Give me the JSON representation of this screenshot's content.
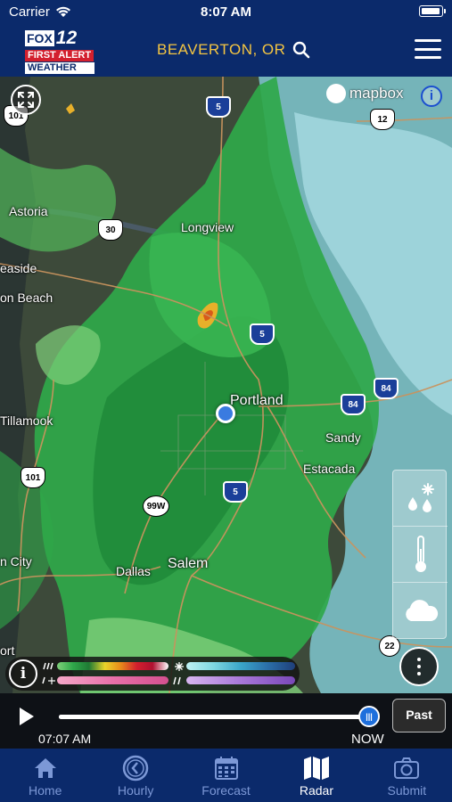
{
  "status_bar": {
    "carrier": "Carrier",
    "time": "8:07 AM"
  },
  "header": {
    "logo_lines": [
      "FOX",
      "12",
      "FIRST ALERT",
      "WEATHER"
    ],
    "location": "BEAVERTON, OR"
  },
  "map": {
    "attribution": "mapbox",
    "cities": [
      {
        "name": "Astoria"
      },
      {
        "name": "Longview"
      },
      {
        "name": "easide"
      },
      {
        "name": "on Beach"
      },
      {
        "name": "Portland"
      },
      {
        "name": "Tillamook"
      },
      {
        "name": "Sandy"
      },
      {
        "name": "Estacada"
      },
      {
        "name": "n City"
      },
      {
        "name": "Dallas"
      },
      {
        "name": "Salem"
      },
      {
        "name": "ort"
      }
    ],
    "shields": [
      {
        "label": "101",
        "kind": "us"
      },
      {
        "label": "5",
        "kind": "interstate"
      },
      {
        "label": "12",
        "kind": "us"
      },
      {
        "label": "30",
        "kind": "us"
      },
      {
        "label": "5",
        "kind": "interstate"
      },
      {
        "label": "84",
        "kind": "interstate"
      },
      {
        "label": "84",
        "kind": "interstate"
      },
      {
        "label": "101",
        "kind": "us"
      },
      {
        "label": "99W",
        "kind": "state"
      },
      {
        "label": "5",
        "kind": "interstate"
      },
      {
        "label": "22",
        "kind": "state"
      }
    ],
    "layer_buttons": [
      "precipitation-type",
      "temperature",
      "clouds"
    ]
  },
  "legend": {
    "info_label": "i"
  },
  "timeline": {
    "start_time": "07:07 AM",
    "end_label": "NOW",
    "progress": 1.0,
    "past_button": "Past"
  },
  "tabs": [
    {
      "label": "Home",
      "icon": "home-icon",
      "active": false
    },
    {
      "label": "Hourly",
      "icon": "clock-icon",
      "active": false
    },
    {
      "label": "Forecast",
      "icon": "calendar-icon",
      "active": false
    },
    {
      "label": "Radar",
      "icon": "map-icon",
      "active": true
    },
    {
      "label": "Submit",
      "icon": "camera-icon",
      "active": false
    }
  ],
  "colors": {
    "header_bg": "#0b2a6b",
    "location_text": "#f4c542",
    "tab_active": "#ffffff",
    "tab_inactive": "#7c98d6",
    "radar_green": "#2fa84a",
    "radar_light_green": "#7fd07a",
    "radar_cyan": "#8fd3dc"
  }
}
